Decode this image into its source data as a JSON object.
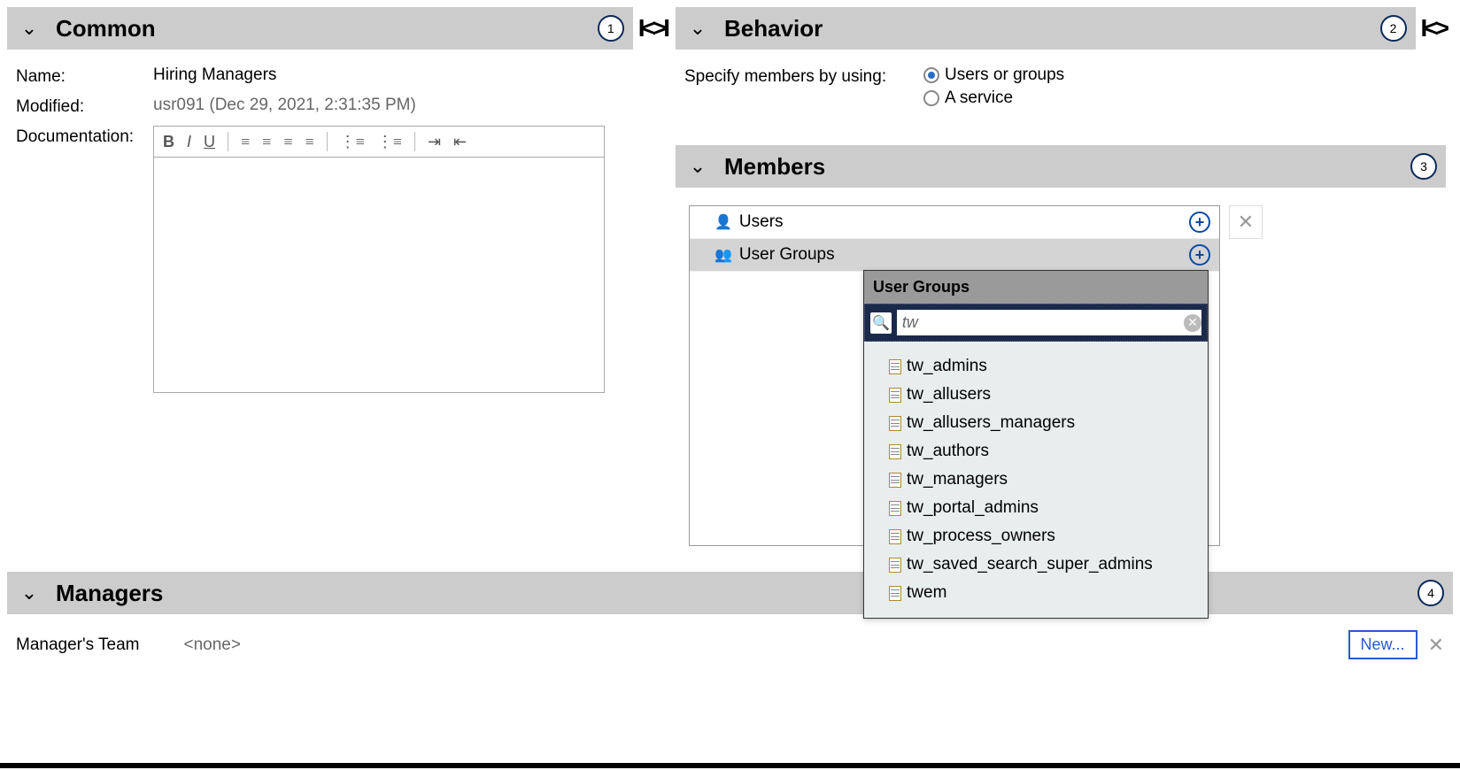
{
  "common": {
    "title": "Common",
    "badge": "1",
    "name_label": "Name:",
    "name_value": "Hiring Managers",
    "modified_label": "Modified:",
    "modified_value": "usr091 (Dec 29, 2021, 2:31:35 PM)",
    "documentation_label": "Documentation:"
  },
  "behavior": {
    "title": "Behavior",
    "badge": "2",
    "specify_label": "Specify members by using:",
    "option1": "Users or groups",
    "option2": "A service"
  },
  "members": {
    "title": "Members",
    "badge": "3",
    "users_label": "Users",
    "usergroups_label": "User Groups",
    "dropdown_title": "User Groups",
    "search_value": "tw",
    "results": [
      "tw_admins",
      "tw_allusers",
      "tw_allusers_managers",
      "tw_authors",
      "tw_managers",
      "tw_portal_admins",
      "tw_process_owners",
      "tw_saved_search_super_admins",
      "twem"
    ]
  },
  "managers": {
    "title": "Managers",
    "badge": "4",
    "team_label": "Manager's Team",
    "team_value": "<none>",
    "new_label": "New..."
  }
}
